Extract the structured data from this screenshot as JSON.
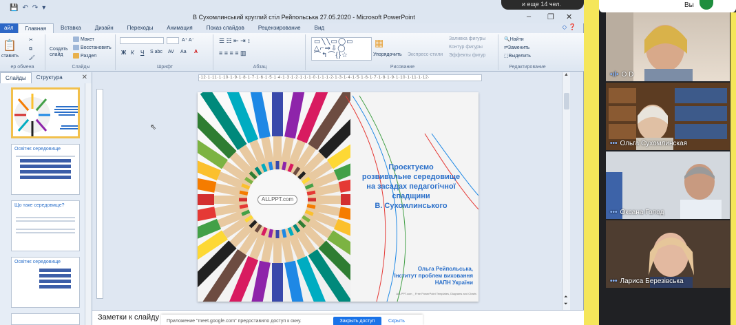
{
  "window": {
    "title": "В Сухомлинський круглий стіл Рейпольська 27.05.2020 - Microsoft PowerPoint",
    "minimize": "–",
    "restore": "❐",
    "close": "✕",
    "overlay": "и еще 14 чел."
  },
  "tabs": [
    "айл",
    "Главная",
    "Вставка",
    "Дизайн",
    "Переходы",
    "Анимация",
    "Показ слайдов",
    "Рецензирование",
    "Вид"
  ],
  "ribbon": {
    "clipboard": {
      "paste": "ставить",
      "label": "ер обмена"
    },
    "slides": {
      "new_slide": "Создать слайд",
      "layout": "Макет",
      "reset": "Восстановить",
      "section": "Раздел",
      "label": "Слайды"
    },
    "font": {
      "bold": "Ж",
      "italic": "К",
      "underline": "Ч",
      "strike": "S abc",
      "spacing": "AV",
      "case": "Аа",
      "grow": "A⁺ A⁻",
      "label": "Шрифт"
    },
    "paragraph": {
      "label": "Абзац"
    },
    "drawing": {
      "arrange": "Упорядочить",
      "styles": "Экспресс-стили",
      "fill": "Заливка фигуры",
      "outline": "Контур фигуры",
      "effects": "Эффекты фигур",
      "label": "Рисование"
    },
    "editing": {
      "find": "Найти",
      "replace": "Заменить",
      "select": "Выделить",
      "label": "Редактирование"
    }
  },
  "left_panel": {
    "tab_slides": "Слайды",
    "tab_outline": "Структура",
    "thumbs": [
      {
        "title": "",
        "selected": true
      },
      {
        "title": "Освітнє середовище",
        "selected": false
      },
      {
        "title": "Що таке середовище?",
        "selected": false
      },
      {
        "title": "Освітнє середовище",
        "selected": false
      }
    ]
  },
  "ruler": "·12·1·11·1·10·1·9·1·8·1·7·1·6·1·5·1·4·1·3·1·2·1·1·1·0·1·1·1·2·1·3·1·4·1·5·1·6·1·7·1·8·1·9·1·10·1·11·1·12·",
  "slide": {
    "logo": "ALLPPT.com",
    "title_lines": [
      "Проєктуємо",
      "розвивальне середовище",
      "на засадах педагогічної",
      "спадщини",
      "В. Сухомлинського"
    ],
    "author_lines": [
      "Ольга Рейпольська,",
      "Інститут проблем виховання",
      "НАПН України"
    ],
    "footer": "ALLPPT.com _ Free PowerPoint Templates, Diagrams and Charts"
  },
  "notes": {
    "label": "Заметки к слайду",
    "share_text": "Приложение \"meet.google.com\" предоставило доступ к окну.",
    "share_button": "Закрыть доступ",
    "share_hide": "Скрыть"
  },
  "meet": {
    "top_text": "Вы",
    "participants": [
      {
        "name": "O D"
      },
      {
        "name": "Ольга Сухомлинская"
      },
      {
        "name": "Оксана Голод"
      },
      {
        "name": "Лариса Березівська"
      }
    ]
  },
  "pencil_colors": [
    "#d32f2f",
    "#f57c00",
    "#fbc02d",
    "#7cb342",
    "#2e7d32",
    "#00897b",
    "#00acc1",
    "#1e88e5",
    "#3949ab",
    "#8e24aa",
    "#d81b60",
    "#6d4c41",
    "#212121",
    "#fdd835",
    "#43a047",
    "#e53935"
  ]
}
